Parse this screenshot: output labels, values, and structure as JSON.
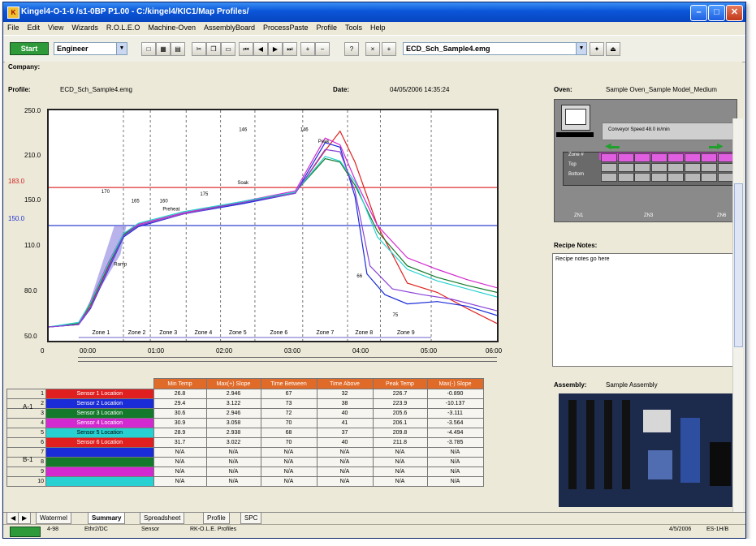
{
  "window": {
    "title": "Kingel4-O-1-6 /s1-0BP P1.00 - C:/kingel4/KIC1/Map Profiles/"
  },
  "menu": [
    "File",
    "Edit",
    "View",
    "Wizards",
    "R.O.L.E.O",
    "Machine-Oven",
    "AssemblyBoard",
    "ProcessPaste",
    "Profile",
    "Tools",
    "Help"
  ],
  "toolbar": {
    "start_label": "Start",
    "user_combo": "Engineer",
    "file_combo": "ECD_Sch_Sample4.emg"
  },
  "company_label": "Company:",
  "profile": {
    "label": "Profile:",
    "value": "ECD_Sch_Sample4.emg",
    "date_label": "Date:",
    "date_value": "04/05/2006 14:35:24"
  },
  "oven": {
    "label": "Oven:",
    "value": "Sample Oven_Sample Model_Medium",
    "speed_label": "Conveyor Speed 48.0 in/min",
    "row_labels": [
      "Zone #",
      "Top",
      "Bottom"
    ],
    "bottom_labels": [
      "ZN1",
      "ZN3",
      "ZN6"
    ]
  },
  "recipe": {
    "label": "Recipe Notes:",
    "text": "Recipe notes go here"
  },
  "assembly": {
    "label": "Assembly:",
    "value": "Sample Assembly"
  },
  "table": {
    "headers": [
      "Min Temp",
      "Max(+) Slope",
      "Time Between",
      "Time Above",
      "Peak Temp",
      "Max(-) Slope"
    ],
    "rows": [
      {
        "num": "1",
        "name": "Sensor 1 Location",
        "vals": [
          "26.8",
          "2.946",
          "67",
          "32",
          "226.7",
          "-0.890"
        ]
      },
      {
        "num": "2",
        "name": "Sensor 2 Location",
        "vals": [
          "29.4",
          "3.122",
          "73",
          "38",
          "223.9",
          "-10.137"
        ]
      },
      {
        "num": "3",
        "name": "Sensor 3 Location",
        "vals": [
          "30.6",
          "2.946",
          "72",
          "40",
          "205.6",
          "-3.111"
        ]
      },
      {
        "num": "4",
        "name": "Sensor 4 Location",
        "vals": [
          "30.9",
          "3.058",
          "70",
          "41",
          "206.1",
          "-3.564"
        ]
      },
      {
        "num": "5",
        "name": "Sensor 5 Location",
        "vals": [
          "28.9",
          "2.938",
          "68",
          "37",
          "209.8",
          "-4.494"
        ]
      },
      {
        "num": "6",
        "name": "Sensor 6 Location",
        "vals": [
          "31.7",
          "3.022",
          "70",
          "40",
          "211.8",
          "-3.785"
        ]
      },
      {
        "num": "7",
        "name": "",
        "vals": [
          "N/A",
          "N/A",
          "N/A",
          "N/A",
          "N/A",
          "N/A"
        ]
      },
      {
        "num": "8",
        "name": "",
        "vals": [
          "N/A",
          "N/A",
          "N/A",
          "N/A",
          "N/A",
          "N/A"
        ]
      },
      {
        "num": "9",
        "name": "",
        "vals": [
          "N/A",
          "N/A",
          "N/A",
          "N/A",
          "N/A",
          "N/A"
        ]
      },
      {
        "num": "10",
        "name": "",
        "vals": [
          "N/A",
          "N/A",
          "N/A",
          "N/A",
          "N/A",
          "N/A"
        ]
      }
    ],
    "colors": [
      "#e02020",
      "#1a2bd8",
      "#137a2b",
      "#d22ad0",
      "#27d1d1",
      "#e02020",
      "#1a2bd8",
      "#137a2b",
      "#d22ad0",
      "#27d1d1"
    ],
    "group_labels": [
      "A-1",
      "B-1"
    ]
  },
  "tabs": [
    "Watermel",
    "Summary",
    "Spreadsheet",
    "Profile",
    "SPC"
  ],
  "active_tab": "Summary",
  "status": {
    "seg1": "4-98",
    "seg2": "Ethr2/DC",
    "seg3": "Sensor",
    "seg4": "RK-O.L.E. Profiles",
    "seg5": "4/5/2006",
    "seg6": "ES-1H/B"
  },
  "chart_data": {
    "type": "line",
    "ylim": [
      50,
      250
    ],
    "y_ticks": [
      50,
      90,
      130,
      170,
      210,
      250
    ],
    "y_tick_labels": [
      "50.0",
      "80.0",
      "110.0",
      "150.0",
      "210.0",
      "250.0"
    ],
    "xlim": [
      0,
      300
    ],
    "x_tick_labels": [
      "00:00",
      "01:00",
      "02:00",
      "03:00",
      "04:00",
      "05:00",
      "06:00"
    ],
    "liquidus_high": 183,
    "liquidus_low": 150,
    "liquidus_high_label": "183.0",
    "liquidus_low_label": "150.0",
    "zones": [
      "Zone 1",
      "Zone 2",
      "Zone 3",
      "Zone 4",
      "Zone 5",
      "Zone 6",
      "Zone 7",
      "Zone 8",
      "Zone 9"
    ],
    "zone_bounds": [
      20,
      50,
      68,
      92,
      115,
      138,
      170,
      200,
      222,
      256,
      300
    ],
    "annotations": [
      {
        "x": 48,
        "y": 115,
        "text": "Ramp"
      },
      {
        "x": 130,
        "y": 186,
        "text": "Soak"
      },
      {
        "x": 82,
        "y": 163,
        "text": "Preheat"
      },
      {
        "x": 184,
        "y": 222,
        "text": "Peak"
      },
      {
        "x": 208,
        "y": 105,
        "text": "66"
      },
      {
        "x": 232,
        "y": 71,
        "text": "75"
      },
      {
        "x": 130,
        "y": 232,
        "text": "146"
      },
      {
        "x": 171,
        "y": 232,
        "text": "146"
      },
      {
        "x": 38,
        "y": 178,
        "text": "170"
      },
      {
        "x": 58,
        "y": 170,
        "text": "165"
      },
      {
        "x": 77,
        "y": 170,
        "text": "160"
      },
      {
        "x": 104,
        "y": 176,
        "text": "175"
      }
    ],
    "series": [
      {
        "color": "#e02020",
        "values": [
          [
            0,
            62
          ],
          [
            20,
            64
          ],
          [
            28,
            80
          ],
          [
            40,
            115
          ],
          [
            50,
            142
          ],
          [
            60,
            150
          ],
          [
            90,
            160
          ],
          [
            130,
            170
          ],
          [
            165,
            178
          ],
          [
            185,
            215
          ],
          [
            195,
            232
          ],
          [
            205,
            205
          ],
          [
            220,
            150
          ],
          [
            240,
            100
          ],
          [
            260,
            92
          ],
          [
            280,
            78
          ],
          [
            300,
            65
          ]
        ]
      },
      {
        "color": "#1a2bd8",
        "values": [
          [
            0,
            62
          ],
          [
            20,
            64
          ],
          [
            28,
            78
          ],
          [
            40,
            112
          ],
          [
            50,
            140
          ],
          [
            60,
            149
          ],
          [
            90,
            160
          ],
          [
            130,
            169
          ],
          [
            165,
            178
          ],
          [
            185,
            222
          ],
          [
            195,
            218
          ],
          [
            205,
            175
          ],
          [
            213,
            108
          ],
          [
            225,
            90
          ],
          [
            240,
            82
          ],
          [
            260,
            84
          ],
          [
            280,
            80
          ],
          [
            300,
            72
          ]
        ]
      },
      {
        "color": "#137a2b",
        "values": [
          [
            0,
            62
          ],
          [
            20,
            65
          ],
          [
            28,
            82
          ],
          [
            40,
            116
          ],
          [
            50,
            142
          ],
          [
            60,
            151
          ],
          [
            90,
            161
          ],
          [
            130,
            170
          ],
          [
            165,
            179
          ],
          [
            185,
            208
          ],
          [
            195,
            205
          ],
          [
            205,
            185
          ],
          [
            220,
            145
          ],
          [
            240,
            115
          ],
          [
            260,
            105
          ],
          [
            280,
            98
          ],
          [
            300,
            92
          ]
        ]
      },
      {
        "color": "#d22ad0",
        "values": [
          [
            0,
            62
          ],
          [
            20,
            64
          ],
          [
            28,
            84
          ],
          [
            40,
            118
          ],
          [
            50,
            143
          ],
          [
            60,
            151
          ],
          [
            90,
            161
          ],
          [
            130,
            171
          ],
          [
            165,
            180
          ],
          [
            185,
            226
          ],
          [
            195,
            220
          ],
          [
            205,
            190
          ],
          [
            220,
            150
          ],
          [
            240,
            122
          ],
          [
            260,
            112
          ],
          [
            280,
            103
          ],
          [
            300,
            96
          ]
        ]
      },
      {
        "color": "#27d1d1",
        "values": [
          [
            0,
            62
          ],
          [
            20,
            66
          ],
          [
            28,
            83
          ],
          [
            40,
            117
          ],
          [
            50,
            143
          ],
          [
            60,
            152
          ],
          [
            90,
            162
          ],
          [
            130,
            171
          ],
          [
            165,
            179
          ],
          [
            185,
            210
          ],
          [
            195,
            206
          ],
          [
            205,
            188
          ],
          [
            220,
            140
          ],
          [
            240,
            112
          ],
          [
            260,
            102
          ],
          [
            280,
            95
          ],
          [
            300,
            88
          ]
        ]
      },
      {
        "color": "#8a45d8",
        "values": [
          [
            0,
            62
          ],
          [
            20,
            64
          ],
          [
            28,
            79
          ],
          [
            40,
            113
          ],
          [
            50,
            141
          ],
          [
            60,
            150
          ],
          [
            90,
            160
          ],
          [
            130,
            170
          ],
          [
            165,
            178
          ],
          [
            185,
            216
          ],
          [
            195,
            214
          ],
          [
            205,
            180
          ],
          [
            215,
            115
          ],
          [
            230,
            95
          ],
          [
            250,
            90
          ],
          [
            270,
            86
          ],
          [
            300,
            76
          ]
        ]
      }
    ]
  }
}
